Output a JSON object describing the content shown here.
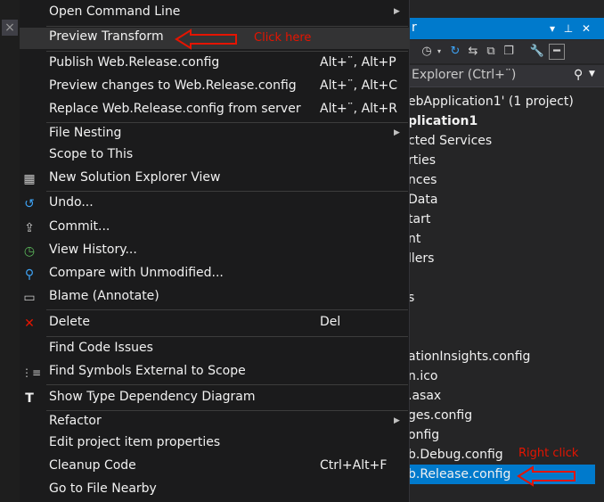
{
  "editor": {
    "tab_close": "×"
  },
  "solution_explorer": {
    "title": "r",
    "title_buttons": {
      "dropdown": "▾",
      "pin": "⊥",
      "close": "✕"
    },
    "search_placeholder": "Explorer (Ctrl+¨)",
    "items": [
      {
        "text": "ebApplication1' (1 project)"
      },
      {
        "text": "plication1"
      },
      {
        "text": "cted Services"
      },
      {
        "text": "rties"
      },
      {
        "text": "nces"
      },
      {
        "text": "Data"
      },
      {
        "text": "tart"
      },
      {
        "text": "nt"
      },
      {
        "text": "llers"
      },
      {
        "text": "s"
      },
      {
        "text": "ationInsights.config"
      },
      {
        "text": "n.ico"
      },
      {
        "text": ".asax"
      },
      {
        "text": "ges.config"
      },
      {
        "text": "onfig"
      },
      {
        "text": "b.Debug.config"
      },
      {
        "text": "b.Release.config"
      }
    ]
  },
  "context_menu": {
    "open_command_line": "Open Command Line",
    "preview_transform": "Preview Transform",
    "publish": "Publish Web.Release.config",
    "publish_shortcut": "Alt+¨, Alt+P",
    "preview_changes": "Preview changes to Web.Release.config",
    "preview_changes_shortcut": "Alt+¨, Alt+C",
    "replace_from_server": "Replace Web.Release.config from server",
    "replace_shortcut": "Alt+¨, Alt+R",
    "file_nesting": "File Nesting",
    "scope_to_this": "Scope to This",
    "new_se_view": "New Solution Explorer View",
    "undo": "Undo...",
    "commit": "Commit...",
    "view_history": "View History...",
    "compare": "Compare with Unmodified...",
    "blame": "Blame (Annotate)",
    "delete": "Delete",
    "delete_shortcut": "Del",
    "find_code_issues": "Find Code Issues",
    "find_symbols": "Find Symbols External to Scope",
    "show_type_dependency": "Show Type Dependency Diagram",
    "refactor": "Refactor",
    "edit_properties": "Edit project item properties",
    "cleanup_code": "Cleanup Code",
    "cleanup_shortcut": "Ctrl+Alt+F",
    "go_to_file_nearby": "Go to File Nearby"
  },
  "annotations": {
    "click_here": "Click here",
    "right_click": "Right click",
    "color": "#e51400"
  }
}
